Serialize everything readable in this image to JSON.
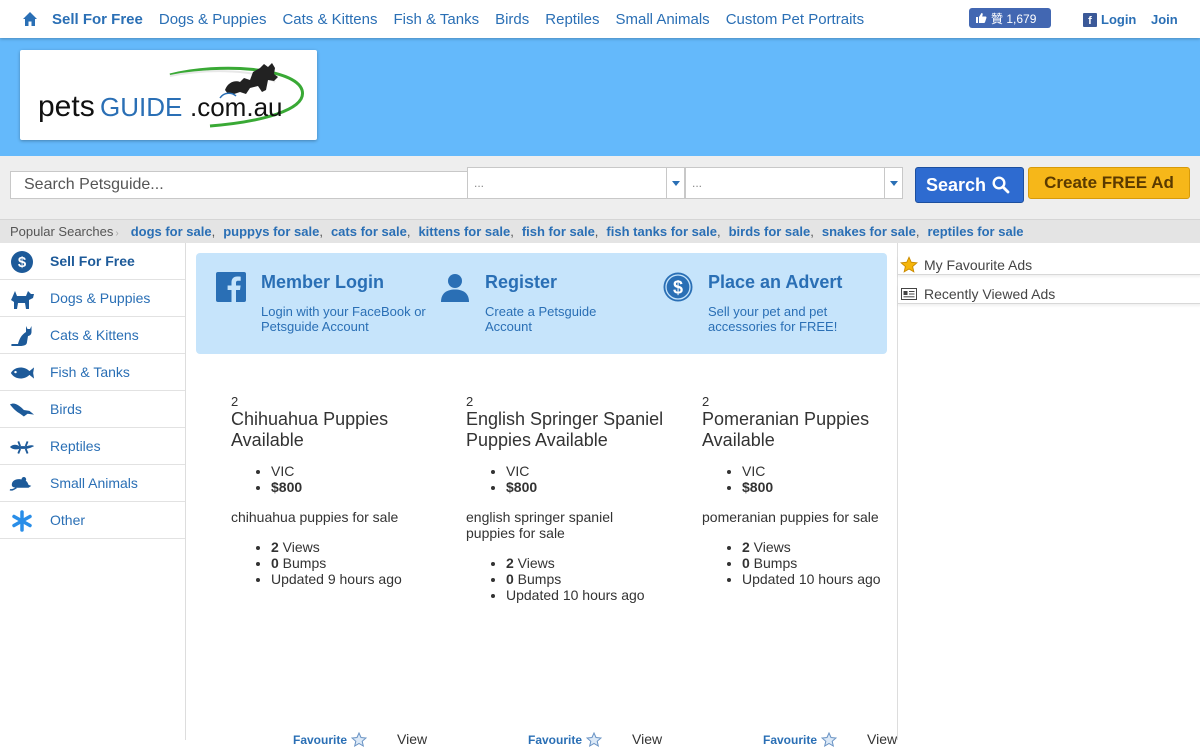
{
  "topnav": {
    "links": [
      {
        "label": "Sell For Free",
        "bold": true
      },
      {
        "label": "Dogs & Puppies"
      },
      {
        "label": "Cats & Kittens"
      },
      {
        "label": "Fish & Tanks"
      },
      {
        "label": "Birds"
      },
      {
        "label": "Reptiles"
      },
      {
        "label": "Small Animals"
      },
      {
        "label": "Custom Pet Portraits"
      }
    ],
    "like_label": "贊 1,679",
    "login_label": "Login",
    "join_label": "Join"
  },
  "logo": {
    "text_pets": "pets",
    "text_guide": "GUIDE",
    "text_domain": ".com.au"
  },
  "search": {
    "placeholder": "Search Petsguide...",
    "select1_value": "...",
    "select2_value": "...",
    "search_button": "Search",
    "create_button": "Create FREE Ad"
  },
  "popular": {
    "label": "Popular Searches",
    "items": [
      "dogs for sale",
      "puppys for sale",
      "cats for sale",
      "kittens for sale",
      "fish for sale",
      "fish tanks for sale",
      "birds for sale",
      "snakes for sale",
      "reptiles for sale"
    ]
  },
  "sidebar": {
    "items": [
      {
        "label": "Sell For Free",
        "icon": "dollar-icon",
        "bold": true
      },
      {
        "label": "Dogs & Puppies",
        "icon": "dog-icon"
      },
      {
        "label": "Cats & Kittens",
        "icon": "cat-icon"
      },
      {
        "label": "Fish & Tanks",
        "icon": "fish-icon"
      },
      {
        "label": "Birds",
        "icon": "bird-icon"
      },
      {
        "label": "Reptiles",
        "icon": "lizard-icon"
      },
      {
        "label": "Small Animals",
        "icon": "mouse-icon"
      },
      {
        "label": "Other",
        "icon": "asterisk-icon"
      }
    ]
  },
  "banner": {
    "login": {
      "title": "Member Login",
      "desc": "Login with your FaceBook or Petsguide Account"
    },
    "register": {
      "title": "Register",
      "desc": "Create a Petsguide Account"
    },
    "advert": {
      "title": "Place an Advert",
      "desc": "Sell your pet and pet accessories for FREE!"
    }
  },
  "listings": [
    {
      "count": "2",
      "title": "Chihuahua Puppies Available",
      "location": "VIC",
      "price": "$800",
      "desc": "chihuahua puppies for sale",
      "views": "2",
      "views_label": " Views",
      "bumps": "0",
      "bumps_label": " Bumps",
      "updated": "Updated 9 hours ago",
      "fav": "Favourite",
      "view": "View"
    },
    {
      "count": "2",
      "title": "English Springer Spaniel Puppies Available",
      "location": "VIC",
      "price": "$800",
      "desc": "english springer spaniel puppies for sale",
      "views": "2",
      "views_label": " Views",
      "bumps": "0",
      "bumps_label": " Bumps",
      "updated": "Updated 10 hours ago",
      "fav": "Favourite",
      "view": "View"
    },
    {
      "count": "2",
      "title": "Pomeranian Puppies Available",
      "location": "VIC",
      "price": "$800",
      "desc": "pomeranian puppies for sale",
      "views": "2",
      "views_label": " Views",
      "bumps": "0",
      "bumps_label": " Bumps",
      "updated": "Updated 10 hours ago",
      "fav": "Favourite",
      "view": "View"
    }
  ],
  "rightpanel": {
    "favourites": "My Favourite Ads",
    "recent": "Recently Viewed Ads"
  },
  "colors": {
    "link": "#2a6fb5",
    "header": "#64b9fb",
    "banner": "#c6e4fb",
    "search_button": "#2e6bd0",
    "create_button": "#f6b719"
  }
}
